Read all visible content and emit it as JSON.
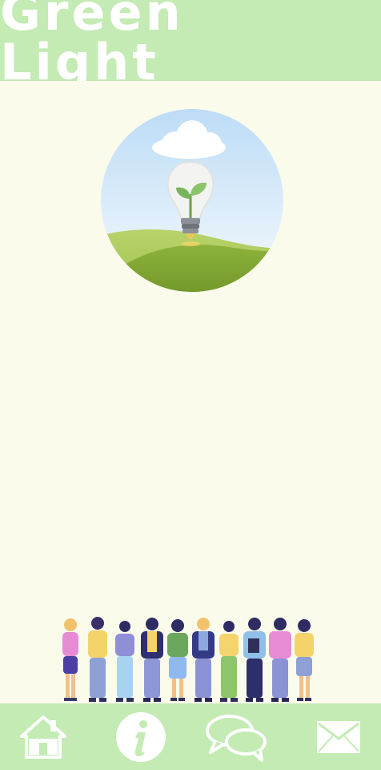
{
  "header": {
    "title": "Green Light"
  },
  "colors": {
    "bar": "#c3ebb3",
    "background": "#fbfbec",
    "icon": "#ffffff"
  },
  "hero": {
    "icon": "lightbulb-sprout-illustration"
  },
  "illustration": {
    "icon": "group-of-people-illustration"
  },
  "nav": {
    "items": [
      {
        "icon": "home-icon"
      },
      {
        "icon": "info-icon"
      },
      {
        "icon": "chat-icon"
      },
      {
        "icon": "mail-icon"
      }
    ]
  }
}
